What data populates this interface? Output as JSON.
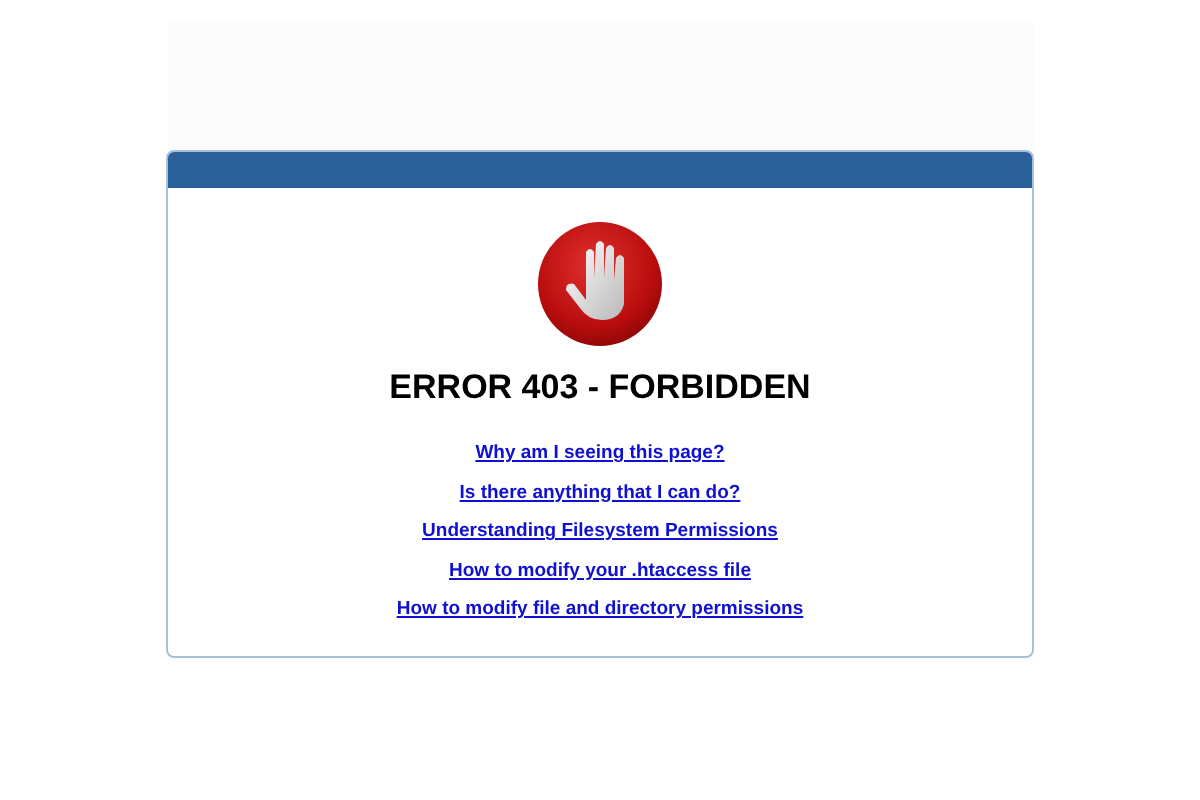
{
  "heading": "ERROR 403 - FORBIDDEN",
  "links": [
    "Why am I seeing this page?",
    "Is there anything that I can do?",
    "Understanding Filesystem Permissions",
    "How to modify your .htaccess file",
    "How to modify file and directory permissions"
  ]
}
